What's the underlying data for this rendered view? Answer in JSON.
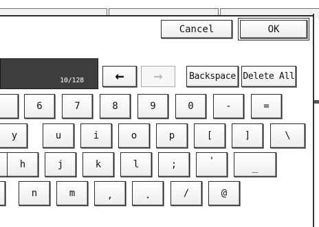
{
  "header": {
    "cancel_label": "Cancel",
    "ok_label": "OK"
  },
  "input": {
    "counter": "10/128"
  },
  "edit": {
    "left_arrow": "←",
    "right_arrow": "→",
    "backspace_label": "Backspace",
    "delete_all_label": "Delete All"
  },
  "keyboard": {
    "row_numbers": [
      "6",
      "7",
      "8",
      "9",
      "0",
      "-",
      "="
    ],
    "row_top": [
      "y",
      "u",
      "i",
      "o",
      "p",
      "[",
      "]",
      "\\"
    ],
    "row_home": [
      "h",
      "j",
      "k",
      "l",
      ";",
      "'",
      "_"
    ],
    "row_bottom": [
      "n",
      "m",
      ",",
      ".",
      "/",
      "@"
    ]
  },
  "colors": {
    "display_bg": "#3e3e3e",
    "key_border": "#2a2a2a",
    "disabled_text": "#b0b0b0"
  }
}
